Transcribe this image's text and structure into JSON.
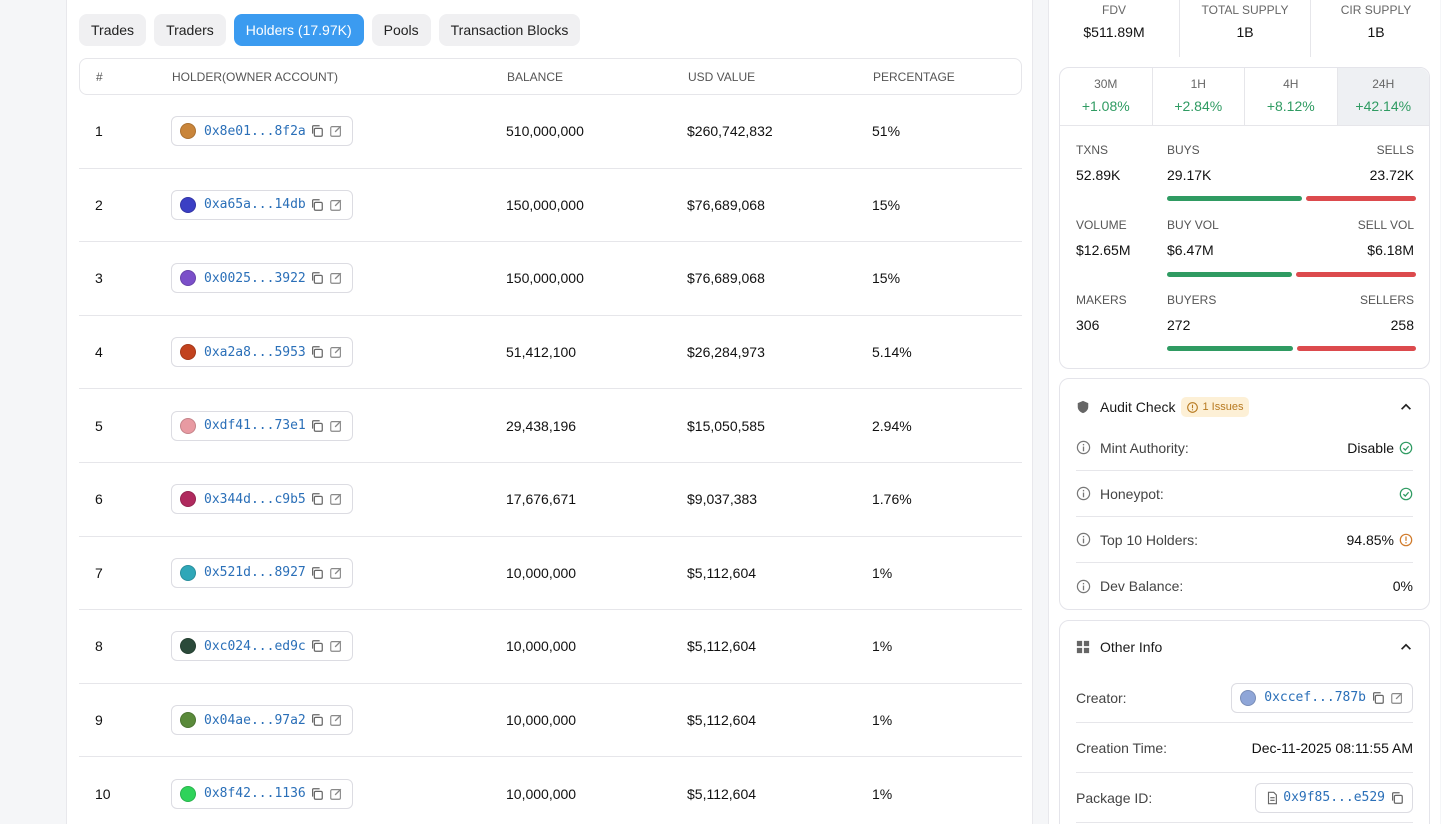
{
  "tabs": [
    {
      "label": "Trades"
    },
    {
      "label": "Traders"
    },
    {
      "label": "Holders (17.97K)"
    },
    {
      "label": "Pools"
    },
    {
      "label": "Transaction Blocks"
    }
  ],
  "table": {
    "headers": {
      "rank": "#",
      "holder": "HOLDER(OWNER ACCOUNT)",
      "balance": "BALANCE",
      "usd": "USD VALUE",
      "pct": "PERCENTAGE"
    },
    "rows": [
      {
        "rank": "1",
        "address": "0x8e01...8f2a",
        "balance": "510,000,000",
        "usd": "$260,742,832",
        "pct": "51%",
        "avatar_color": "#c9853a"
      },
      {
        "rank": "2",
        "address": "0xa65a...14db",
        "balance": "150,000,000",
        "usd": "$76,689,068",
        "pct": "15%",
        "avatar_color": "#3b3fc4"
      },
      {
        "rank": "3",
        "address": "0x0025...3922",
        "balance": "150,000,000",
        "usd": "$76,689,068",
        "pct": "15%",
        "avatar_color": "#7b4fc9"
      },
      {
        "rank": "4",
        "address": "0xa2a8...5953",
        "balance": "51,412,100",
        "usd": "$26,284,973",
        "pct": "5.14%",
        "avatar_color": "#c2421e"
      },
      {
        "rank": "5",
        "address": "0xdf41...73e1",
        "balance": "29,438,196",
        "usd": "$15,050,585",
        "pct": "2.94%",
        "avatar_color": "#e89aa2"
      },
      {
        "rank": "6",
        "address": "0x344d...c9b5",
        "balance": "17,676,671",
        "usd": "$9,037,383",
        "pct": "1.76%",
        "avatar_color": "#b02a5e"
      },
      {
        "rank": "7",
        "address": "0x521d...8927",
        "balance": "10,000,000",
        "usd": "$5,112,604",
        "pct": "1%",
        "avatar_color": "#2fa7b8"
      },
      {
        "rank": "8",
        "address": "0xc024...ed9c",
        "balance": "10,000,000",
        "usd": "$5,112,604",
        "pct": "1%",
        "avatar_color": "#2b4a3a"
      },
      {
        "rank": "9",
        "address": "0x04ae...97a2",
        "balance": "10,000,000",
        "usd": "$5,112,604",
        "pct": "1%",
        "avatar_color": "#5a8a3a"
      },
      {
        "rank": "10",
        "address": "0x8f42...1136",
        "balance": "10,000,000",
        "usd": "$5,112,604",
        "pct": "1%",
        "avatar_color": "#2fd35a"
      }
    ]
  },
  "summary": {
    "fdv_label": "FDV",
    "fdv": "$511.89M",
    "total_supply_label": "TOTAL SUPPLY",
    "total_supply": "1B",
    "cir_supply_label": "CIR SUPPLY",
    "cir_supply": "1B"
  },
  "timeframes": [
    {
      "label": "30M",
      "value": "+1.08%"
    },
    {
      "label": "1H",
      "value": "+2.84%"
    },
    {
      "label": "4H",
      "value": "+8.12%"
    },
    {
      "label": "24H",
      "value": "+42.14%"
    }
  ],
  "metrics": {
    "txns": {
      "l1": "TXNS",
      "v1": "52.89K",
      "l2": "BUYS",
      "v2": "29.17K",
      "l3": "SELLS",
      "v3": "23.72K",
      "buy_share": 0.5515
    },
    "volume": {
      "l1": "VOLUME",
      "v1": "$12.65M",
      "l2": "BUY VOL",
      "v2": "$6.47M",
      "l3": "SELL VOL",
      "v3": "$6.18M",
      "buy_share": 0.5115
    },
    "makers": {
      "l1": "MAKERS",
      "v1": "306",
      "l2": "BUYERS",
      "v2": "272",
      "l3": "SELLERS",
      "v3": "258",
      "buy_share": 0.5132
    }
  },
  "audit": {
    "title": "Audit Check",
    "badge": "1 Issues",
    "rows": [
      {
        "label": "Mint Authority:",
        "value": "Disable",
        "status": "ok"
      },
      {
        "label": "Honeypot:",
        "value": "",
        "status": "ok"
      },
      {
        "label": "Top 10 Holders:",
        "value": "94.85%",
        "status": "warn"
      },
      {
        "label": "Dev Balance:",
        "value": "0%",
        "status": "none"
      }
    ]
  },
  "other": {
    "title": "Other Info",
    "creator_label": "Creator:",
    "creator": "0xccef...787b",
    "creation_label": "Creation Time:",
    "creation": "Dec-11-2025 08:11:55 AM",
    "package_label": "Package ID:",
    "package": "0x9f85...e529"
  },
  "colors": {
    "accent": "#3b9bf0",
    "green": "#2f9b62",
    "red": "#dc4a4d",
    "link": "#2a6fb8"
  }
}
